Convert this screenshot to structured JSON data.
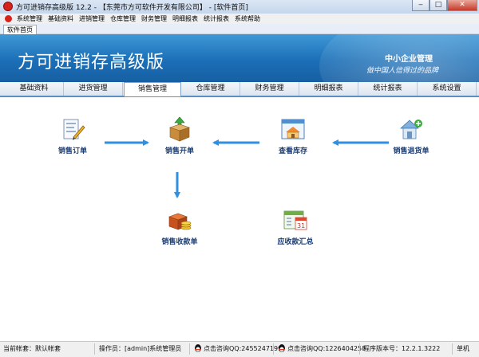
{
  "window": {
    "title": "方可进销存高级版 12.2 - 【东莞市方可软件开发有限公司】 - [软件首页]"
  },
  "menu": [
    "系统管理",
    "基础资料",
    "进销管理",
    "仓库管理",
    "财务管理",
    "明细报表",
    "统计报表",
    "系统帮助"
  ],
  "doc_tab": "软件首页",
  "banner": {
    "title": "方可进销存高级版",
    "slogan1": "中小企业管理",
    "slogan2": "做中国人信得过的品牌"
  },
  "nav_tabs": [
    "基础资料",
    "进货管理",
    "销售管理",
    "仓库管理",
    "财务管理",
    "明细报表",
    "统计报表",
    "系统设置"
  ],
  "active_tab": "销售管理",
  "modules": {
    "sales_order": "销售订单",
    "sales_invoice": "销售开单",
    "view_stock": "查看库存",
    "sales_return": "销售退货单",
    "sales_receipt": "销售收款单",
    "receivables_summary": "应收款汇总"
  },
  "status": {
    "account": "当前帐套：默认帐套",
    "operator": "操作员：[admin]系统管理员",
    "qq1": "点击咨询QQ:2455247199",
    "qq2": "点击咨询QQ:1226404258",
    "version": "程序版本号：12.2.1.3222",
    "mode": "单机"
  },
  "colors": {
    "banner": "#1b6fb7",
    "arrow": "#2f8fe0",
    "label": "#1c3e74"
  }
}
